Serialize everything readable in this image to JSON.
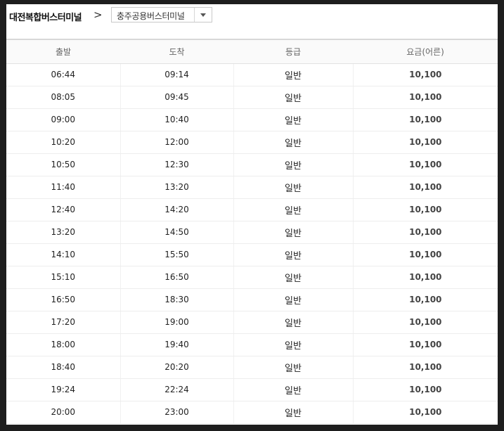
{
  "route": {
    "origin": "대전복합버스터미널",
    "arrow": ">",
    "destination": "충주공용버스터미널"
  },
  "table": {
    "headers": [
      "출발",
      "도착",
      "등급",
      "요금(어른)"
    ],
    "rows": [
      [
        "06:44",
        "09:14",
        "일반",
        "10,100"
      ],
      [
        "08:05",
        "09:45",
        "일반",
        "10,100"
      ],
      [
        "09:00",
        "10:40",
        "일반",
        "10,100"
      ],
      [
        "10:20",
        "12:00",
        "일반",
        "10,100"
      ],
      [
        "10:50",
        "12:30",
        "일반",
        "10,100"
      ],
      [
        "11:40",
        "13:20",
        "일반",
        "10,100"
      ],
      [
        "12:40",
        "14:20",
        "일반",
        "10,100"
      ],
      [
        "13:20",
        "14:50",
        "일반",
        "10,100"
      ],
      [
        "14:10",
        "15:50",
        "일반",
        "10,100"
      ],
      [
        "15:10",
        "16:50",
        "일반",
        "10,100"
      ],
      [
        "16:50",
        "18:30",
        "일반",
        "10,100"
      ],
      [
        "17:20",
        "19:00",
        "일반",
        "10,100"
      ],
      [
        "18:00",
        "19:40",
        "일반",
        "10,100"
      ],
      [
        "18:40",
        "20:20",
        "일반",
        "10,100"
      ],
      [
        "19:24",
        "22:24",
        "일반",
        "10,100"
      ],
      [
        "20:00",
        "23:00",
        "일반",
        "10,100"
      ]
    ]
  }
}
